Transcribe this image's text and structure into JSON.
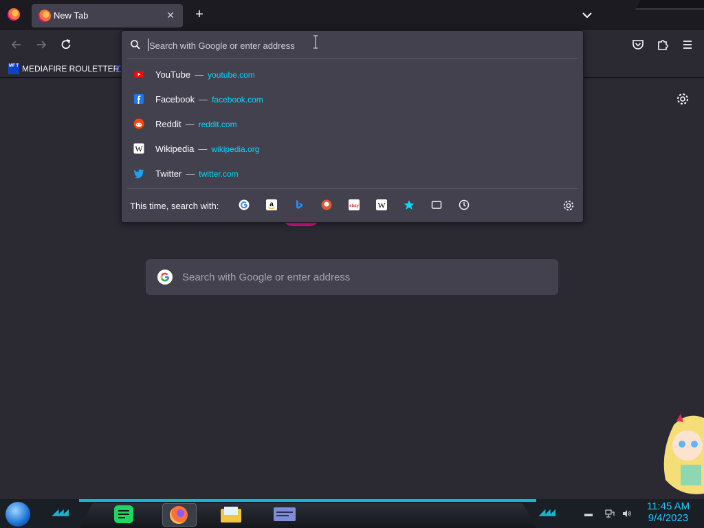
{
  "browser": {
    "tab": {
      "title": "New Tab"
    },
    "bookmarks": [
      {
        "label": "MEDIAFIRE ROULETTER",
        "icon_text": "MF T"
      }
    ],
    "urlbar": {
      "placeholder": "Search with Google or enter address",
      "value": "",
      "suggestions": [
        {
          "title": "YouTube",
          "url": "youtube.com",
          "icon": "youtube-icon",
          "color": "#ff0000"
        },
        {
          "title": "Facebook",
          "url": "facebook.com",
          "icon": "facebook-icon",
          "color": "#1877f2"
        },
        {
          "title": "Reddit",
          "url": "reddit.com",
          "icon": "reddit-icon",
          "color": "#ff4500"
        },
        {
          "title": "Wikipedia",
          "url": "wikipedia.org",
          "icon": "wikipedia-icon",
          "color": "#ffffff"
        },
        {
          "title": "Twitter",
          "url": "twitter.com",
          "icon": "twitter-icon",
          "color": "#1da1f2"
        }
      ],
      "separator": "—",
      "one_off_label": "This time, search with:",
      "engines": [
        "google-icon",
        "amazon-icon",
        "bing-icon",
        "duckduckgo-icon",
        "ebay-icon",
        "wikipedia-icon",
        "bookmarks-star-icon",
        "tabs-icon",
        "history-icon"
      ]
    },
    "newtab": {
      "search_placeholder": "Search with Google or enter address"
    }
  },
  "taskbar": {
    "time": "11:45 AM",
    "date": "9/4/2023",
    "apps": [
      "spotify-icon",
      "firefox-icon",
      "file-explorer-icon",
      "app-window-icon"
    ]
  },
  "colors": {
    "accent_link": "#00ddff",
    "taskbar_neon": "#17b6cf",
    "clock": "#1ec8ff"
  }
}
